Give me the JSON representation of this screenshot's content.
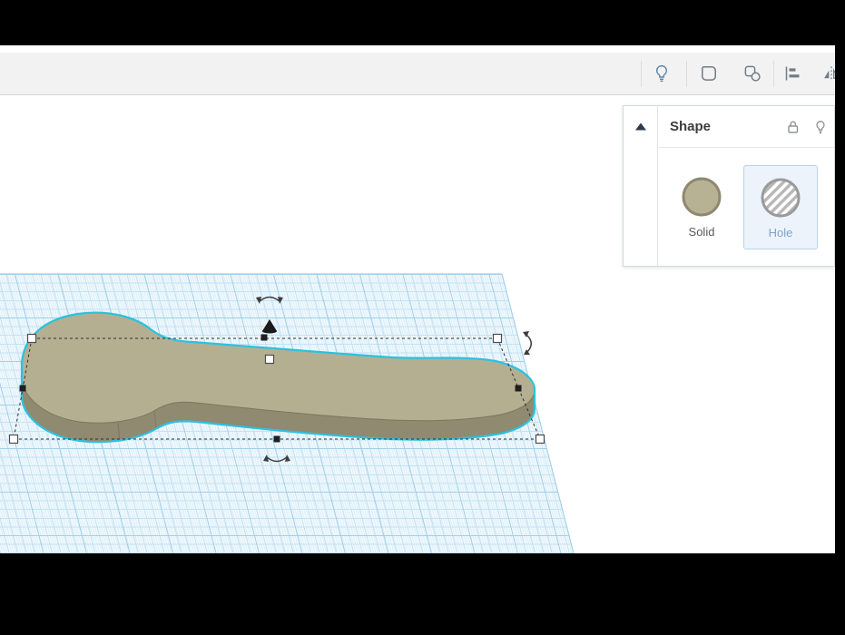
{
  "toolbar": {
    "buttons": [
      {
        "name": "visibility",
        "icon": "lightbulb-icon"
      },
      {
        "name": "group",
        "icon": "group-icon"
      },
      {
        "name": "ungroup",
        "icon": "ungroup-icon"
      },
      {
        "name": "align",
        "icon": "align-icon"
      },
      {
        "name": "mirror",
        "icon": "mirror-icon"
      }
    ]
  },
  "shape_panel": {
    "title": "Shape",
    "collapse_icon": "chevron-up-icon",
    "header_icons": [
      "lock-icon",
      "lightbulb-icon"
    ],
    "options": [
      {
        "label": "Solid",
        "selected": false
      },
      {
        "label": "Hole",
        "selected": true
      }
    ]
  },
  "colors": {
    "selection_outline": "#2bc2de",
    "shape_top": "#b5af92",
    "shape_side": "#8f8a70",
    "shape_edge": "#7c775f",
    "solid_swatch": "#b8b295",
    "hole_card_bg": "#ecf3fb",
    "hole_card_border": "#bad3ec",
    "hole_label": "#7fa3cb",
    "workplane_minor_line": "#c3e3f4",
    "workplane_major_line": "#a0d0ea",
    "workplane_bg": "#f2f9fd"
  }
}
